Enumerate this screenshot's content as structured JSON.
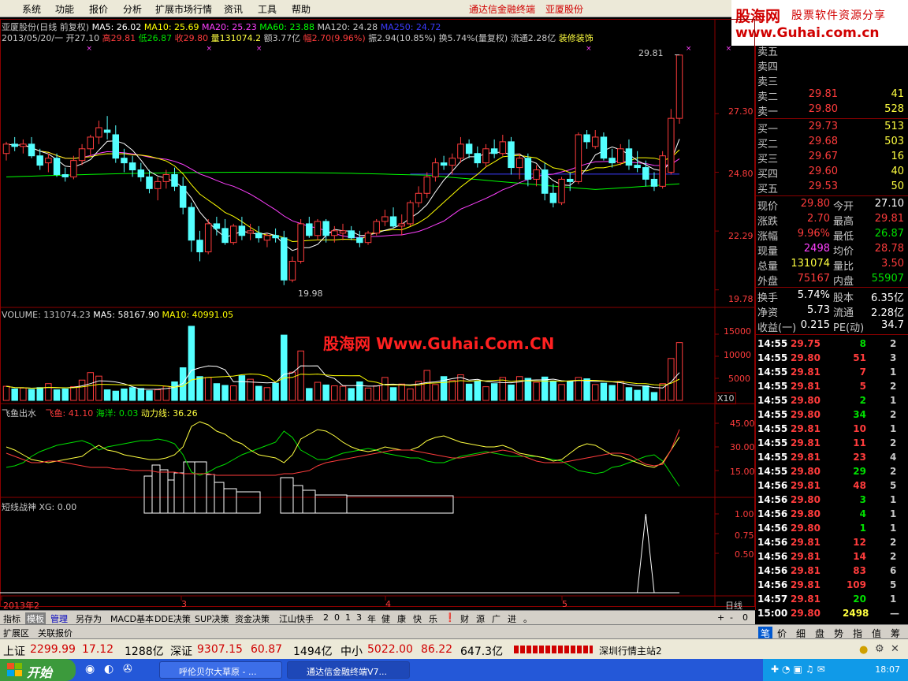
{
  "menu": {
    "items": [
      "系统",
      "功能",
      "报价",
      "分析",
      "扩展市场行情",
      "资讯",
      "工具",
      "帮助"
    ],
    "right_title": "通达信金融终端",
    "right_stock": "亚厦股份"
  },
  "logo": {
    "brand": "股海网",
    "tagline": "股票软件资源分享",
    "url": "www.Guhai.com.cn"
  },
  "chart_header": {
    "stock": "亚厦股份(日线 前复权)",
    "ma5": "MA5: 26.02",
    "ma10": "MA10: 25.69",
    "ma20": "MA20: 25.23",
    "ma60": "MA60: 23.88",
    "ma120": "MA120: 24.28",
    "ma250": "MA250: 24.72"
  },
  "info_line": {
    "date": "2013/05/20/一",
    "open": "开27.10",
    "high": "高29.81",
    "low": "低26.87",
    "close": "收29.80",
    "vol": "量131074.2",
    "amt": "额3.77亿",
    "fu": "幅2.70(9.96%)",
    "zhen": "振2.94(10.85%)",
    "huan": "换5.74%(量复权)",
    "liutong": "流通2.28亿",
    "industry": "装修装饰"
  },
  "price_axis": [
    "27.30",
    "24.80",
    "22.29",
    "19.78"
  ],
  "price_notes": {
    "high": "29.81",
    "low": "19.98"
  },
  "volume_header": {
    "vol": "VOLUME: 131074.23",
    "ma5": "MA5: 58167.90",
    "ma10": "MA10: 40991.05"
  },
  "volume_axis": [
    "15000",
    "10000",
    "5000"
  ],
  "volume_unit": "X10",
  "watermark": "股海网 Www.Guhai.Com.CN",
  "ind1_header": {
    "name": "飞鱼出水",
    "fy": "飞鱼: 41.10",
    "hy": "海洋: 0.03",
    "dl": "动力线: 36.26"
  },
  "ind1_axis": [
    "45.00",
    "30.00",
    "15.00"
  ],
  "ind2_header": {
    "name": "短线战神",
    "xg": "XG: 0.00"
  },
  "ind2_axis": [
    "1.00",
    "0.75",
    "0.50"
  ],
  "date_axis": {
    "year": "2013年2",
    "m3": "3",
    "m4": "4",
    "m5": "5",
    "period": "日线"
  },
  "quote": {
    "sells": [
      {
        "label": "卖五",
        "price": "",
        "vol": ""
      },
      {
        "label": "卖四",
        "price": "",
        "vol": ""
      },
      {
        "label": "卖三",
        "price": "",
        "vol": ""
      },
      {
        "label": "卖二",
        "price": "29.81",
        "vol": "41"
      },
      {
        "label": "卖一",
        "price": "29.80",
        "vol": "528"
      }
    ],
    "buys": [
      {
        "label": "买一",
        "price": "29.73",
        "vol": "513"
      },
      {
        "label": "买二",
        "price": "29.68",
        "vol": "503"
      },
      {
        "label": "买三",
        "price": "29.67",
        "vol": "16"
      },
      {
        "label": "买四",
        "price": "29.60",
        "vol": "40"
      },
      {
        "label": "买五",
        "price": "29.53",
        "vol": "50"
      }
    ],
    "stats": [
      {
        "l1": "现价",
        "v1": "29.80",
        "l2": "今开",
        "v2": "27.10",
        "c1": "#ff3c3c",
        "c2": "#ffffff"
      },
      {
        "l1": "涨跌",
        "v1": "2.70",
        "l2": "最高",
        "v2": "29.81",
        "c1": "#ff3c3c",
        "c2": "#ff3c3c"
      },
      {
        "l1": "涨幅",
        "v1": "9.96%",
        "l2": "最低",
        "v2": "26.87",
        "c1": "#ff3c3c",
        "c2": "#00e000"
      },
      {
        "l1": "现量",
        "v1": "2498",
        "l2": "均价",
        "v2": "28.78",
        "c1": "#ff40ff",
        "c2": "#ff3c3c"
      },
      {
        "l1": "总量",
        "v1": "131074",
        "l2": "量比",
        "v2": "3.50",
        "c1": "#ffff40",
        "c2": "#ff3c3c"
      },
      {
        "l1": "外盘",
        "v1": "75167",
        "l2": "内盘",
        "v2": "55907",
        "c1": "#ff3c3c",
        "c2": "#00e000"
      },
      {
        "l1": "换手",
        "v1": "5.74%",
        "l2": "股本",
        "v2": "6.35亿",
        "c1": "#ffffff",
        "c2": "#ffffff"
      },
      {
        "l1": "净资",
        "v1": "5.73",
        "l2": "流通",
        "v2": "2.28亿",
        "c1": "#ffffff",
        "c2": "#ffffff"
      },
      {
        "l1": "收益(一)",
        "v1": "0.215",
        "l2": "PE(动)",
        "v2": "34.7",
        "c1": "#ffffff",
        "c2": "#ffffff"
      }
    ]
  },
  "ticks": [
    {
      "t": "14:55",
      "p": "29.75",
      "v": "8",
      "n": "2",
      "c": "#00e000"
    },
    {
      "t": "14:55",
      "p": "29.80",
      "v": "51",
      "n": "3",
      "c": "#ff3c3c"
    },
    {
      "t": "14:55",
      "p": "29.81",
      "v": "7",
      "n": "1",
      "c": "#ff3c3c"
    },
    {
      "t": "14:55",
      "p": "29.81",
      "v": "5",
      "n": "2",
      "c": "#ff3c3c"
    },
    {
      "t": "14:55",
      "p": "29.80",
      "v": "2",
      "n": "1",
      "c": "#00e000"
    },
    {
      "t": "14:55",
      "p": "29.80",
      "v": "34",
      "n": "2",
      "c": "#00e000"
    },
    {
      "t": "14:55",
      "p": "29.81",
      "v": "10",
      "n": "1",
      "c": "#ff3c3c"
    },
    {
      "t": "14:55",
      "p": "29.81",
      "v": "11",
      "n": "2",
      "c": "#ff3c3c"
    },
    {
      "t": "14:55",
      "p": "29.81",
      "v": "23",
      "n": "4",
      "c": "#ff3c3c"
    },
    {
      "t": "14:55",
      "p": "29.80",
      "v": "29",
      "n": "2",
      "c": "#00e000"
    },
    {
      "t": "14:56",
      "p": "29.81",
      "v": "48",
      "n": "5",
      "c": "#ff3c3c"
    },
    {
      "t": "14:56",
      "p": "29.80",
      "v": "3",
      "n": "1",
      "c": "#00e000"
    },
    {
      "t": "14:56",
      "p": "29.80",
      "v": "4",
      "n": "1",
      "c": "#00e000"
    },
    {
      "t": "14:56",
      "p": "29.80",
      "v": "1",
      "n": "1",
      "c": "#00e000"
    },
    {
      "t": "14:56",
      "p": "29.81",
      "v": "12",
      "n": "2",
      "c": "#ff3c3c"
    },
    {
      "t": "14:56",
      "p": "29.81",
      "v": "14",
      "n": "2",
      "c": "#ff3c3c"
    },
    {
      "t": "14:56",
      "p": "29.81",
      "v": "83",
      "n": "6",
      "c": "#ff3c3c"
    },
    {
      "t": "14:56",
      "p": "29.81",
      "v": "109",
      "n": "5",
      "c": "#ff3c3c"
    },
    {
      "t": "14:57",
      "p": "29.81",
      "v": "20",
      "n": "1",
      "c": "#00e000"
    },
    {
      "t": "15:00",
      "p": "29.80",
      "v": "2498",
      "n": "—",
      "c": "#ffff40"
    }
  ],
  "bottom_tabs": [
    "指标",
    "模板",
    "管理",
    "另存为",
    "MACD基本",
    "DDE决策",
    "SUP决策",
    "资金决策",
    "江山快手",
    "2",
    "0",
    "1",
    "3",
    "年",
    "健",
    "康",
    "快",
    "乐",
    "❗",
    "财",
    "源",
    "广",
    "进",
    "。"
  ],
  "bottom_right": [
    "+",
    "-",
    "0"
  ],
  "tabs2": [
    "扩展区",
    "关联报价"
  ],
  "right_tabs": [
    "笔",
    "价",
    "细",
    "盘",
    "势",
    "指",
    "值",
    "筹"
  ],
  "index_bar": {
    "sh_label": "上证",
    "sh_val": "2299.99",
    "sh_chg": "17.12",
    "sh_amt": "1288亿",
    "sz_label": "深证",
    "sz_val": "9307.15",
    "sz_chg": "60.87",
    "sz_amt": "1494亿",
    "zx_label": "中小",
    "zx_val": "5022.00",
    "zx_chg": "86.22",
    "zx_amt": "647.3亿",
    "server": "深圳行情主站2"
  },
  "taskbar": {
    "start": "开始",
    "task1": "呼伦贝尔大草原 - ...",
    "task2": "通达信金融终端V7...",
    "clock": "18:07"
  },
  "chart_data": {
    "type": "candlestick",
    "price_range": [
      19.78,
      29.81
    ],
    "candles": [
      [
        25.6,
        26.1,
        25.3,
        26.0
      ],
      [
        26.0,
        26.3,
        25.7,
        25.9
      ],
      [
        25.9,
        26.2,
        25.6,
        26.0
      ],
      [
        26.0,
        26.3,
        25.4,
        25.5
      ],
      [
        25.5,
        25.8,
        24.9,
        25.1
      ],
      [
        25.2,
        25.6,
        24.8,
        25.4
      ],
      [
        25.4,
        25.6,
        24.6,
        24.7
      ],
      [
        24.7,
        25.0,
        24.4,
        24.6
      ],
      [
        24.6,
        25.5,
        24.5,
        25.3
      ],
      [
        25.3,
        26.0,
        25.1,
        25.8
      ],
      [
        25.8,
        26.4,
        25.5,
        26.3
      ],
      [
        26.3,
        27.0,
        26.0,
        26.7
      ],
      [
        26.6,
        27.2,
        26.2,
        26.5
      ],
      [
        26.4,
        26.8,
        25.2,
        25.4
      ],
      [
        25.4,
        25.8,
        24.8,
        25.2
      ],
      [
        25.2,
        25.5,
        24.6,
        24.9
      ],
      [
        24.9,
        25.2,
        24.4,
        24.6
      ],
      [
        24.6,
        24.9,
        23.9,
        24.1
      ],
      [
        24.1,
        24.6,
        23.6,
        24.4
      ],
      [
        24.4,
        24.9,
        24.1,
        24.7
      ],
      [
        24.7,
        25.0,
        24.0,
        24.2
      ],
      [
        24.2,
        24.6,
        23.0,
        23.3
      ],
      [
        23.3,
        23.5,
        21.4,
        21.9
      ],
      [
        21.9,
        22.3,
        21.0,
        21.4
      ],
      [
        21.4,
        22.8,
        21.3,
        22.6
      ],
      [
        22.6,
        22.9,
        22.1,
        22.4
      ],
      [
        22.4,
        22.8,
        21.7,
        21.8
      ],
      [
        21.8,
        22.6,
        21.7,
        22.5
      ],
      [
        22.5,
        22.9,
        21.9,
        22.1
      ],
      [
        22.2,
        22.6,
        21.9,
        22.3
      ],
      [
        22.2,
        22.5,
        21.8,
        22.0
      ],
      [
        21.9,
        22.2,
        21.6,
        22.1
      ],
      [
        22.1,
        22.4,
        21.8,
        22.0
      ],
      [
        22.0,
        22.3,
        19.98,
        20.2
      ],
      [
        20.2,
        21.2,
        20.1,
        21.0
      ],
      [
        21.0,
        22.8,
        20.9,
        22.6
      ],
      [
        22.6,
        22.9,
        22.0,
        22.1
      ],
      [
        22.1,
        22.8,
        21.9,
        22.7
      ],
      [
        22.7,
        22.8,
        21.8,
        22.1
      ],
      [
        22.1,
        22.5,
        21.8,
        22.3
      ],
      [
        22.2,
        22.6,
        21.9,
        22.3
      ],
      [
        22.3,
        22.5,
        21.9,
        22.0
      ],
      [
        22.0,
        22.3,
        21.6,
        21.8
      ],
      [
        21.8,
        22.3,
        21.7,
        22.2
      ],
      [
        22.2,
        22.8,
        22.1,
        22.7
      ],
      [
        22.7,
        23.2,
        22.5,
        22.9
      ],
      [
        22.9,
        23.3,
        22.4,
        22.5
      ],
      [
        22.5,
        23.0,
        22.1,
        22.6
      ],
      [
        22.6,
        23.6,
        22.5,
        23.5
      ],
      [
        23.5,
        24.2,
        23.3,
        23.9
      ],
      [
        23.9,
        24.8,
        23.7,
        24.6
      ],
      [
        24.6,
        25.4,
        24.4,
        25.2
      ],
      [
        25.2,
        25.5,
        24.9,
        25.1
      ],
      [
        25.1,
        25.6,
        24.7,
        25.4
      ],
      [
        25.4,
        26.3,
        25.2,
        26.0
      ],
      [
        26.0,
        26.2,
        25.4,
        25.6
      ],
      [
        25.6,
        25.9,
        25.0,
        25.2
      ],
      [
        25.2,
        26.0,
        25.0,
        25.8
      ],
      [
        25.8,
        26.2,
        25.4,
        25.6
      ],
      [
        25.6,
        26.4,
        25.5,
        26.1
      ],
      [
        26.1,
        26.3,
        24.7,
        25.0
      ],
      [
        25.0,
        25.6,
        24.5,
        25.4
      ],
      [
        25.4,
        25.6,
        24.2,
        24.5
      ],
      [
        24.5,
        25.1,
        24.2,
        24.9
      ],
      [
        24.9,
        25.2,
        23.6,
        23.9
      ],
      [
        23.9,
        24.3,
        23.3,
        23.5
      ],
      [
        23.5,
        24.6,
        23.4,
        24.5
      ],
      [
        24.5,
        24.8,
        24.0,
        24.4
      ],
      [
        24.4,
        26.5,
        24.3,
        26.4
      ],
      [
        26.4,
        26.6,
        25.8,
        26.1
      ],
      [
        25.9,
        26.6,
        25.8,
        26.3
      ],
      [
        26.3,
        26.5,
        25.3,
        25.4
      ],
      [
        25.4,
        25.8,
        25.0,
        25.2
      ],
      [
        25.2,
        26.0,
        25.1,
        25.8
      ],
      [
        25.8,
        26.2,
        24.9,
        25.1
      ],
      [
        25.1,
        25.7,
        24.8,
        25.0
      ],
      [
        25.0,
        25.3,
        24.2,
        24.5
      ],
      [
        24.5,
        24.8,
        24.0,
        24.2
      ],
      [
        24.2,
        25.7,
        24.1,
        25.5
      ],
      [
        24.8,
        27.5,
        24.7,
        27.1
      ],
      [
        27.1,
        29.81,
        26.87,
        29.8
      ]
    ],
    "volume": [
      3200,
      2600,
      2800,
      2500,
      2900,
      3800,
      2400,
      2600,
      3100,
      4600,
      6300,
      5500,
      2400,
      2100,
      2600,
      2900,
      2700,
      2200,
      2400,
      3200,
      4200,
      7400,
      16800,
      5400,
      5200,
      3800,
      3400,
      3300,
      5600,
      4800,
      3200,
      2900,
      3900,
      14800,
      6400,
      11200,
      2700,
      4100,
      3500,
      3300,
      3200,
      2700,
      4200,
      2800,
      3300,
      5200,
      2900,
      3700,
      2600,
      4300,
      6800,
      3600,
      5400,
      4500,
      5800,
      3700,
      4400,
      3100,
      3800,
      5200,
      3500,
      5400,
      5000,
      4100,
      5300,
      4300,
      3600,
      4200,
      5200,
      4900,
      3600,
      3900,
      3400,
      4300,
      2900,
      2300,
      3300,
      1800,
      3800,
      9500,
      13100
    ],
    "ind1_red": [
      26,
      24,
      22,
      20,
      20,
      21,
      21,
      20,
      19,
      18,
      17,
      17,
      17,
      16,
      16,
      15,
      15,
      15,
      14,
      14,
      14,
      13,
      13,
      13,
      13,
      12,
      12,
      12,
      12,
      12,
      12,
      12,
      12,
      13,
      13,
      14,
      15,
      18,
      20,
      21,
      22,
      23,
      24,
      25,
      26,
      27,
      28,
      28,
      28,
      27,
      26,
      25,
      24,
      23,
      23,
      24,
      25,
      26,
      27,
      28,
      27,
      25,
      23,
      21,
      20,
      20,
      20,
      21,
      22,
      23,
      24,
      25,
      26,
      26,
      25,
      22,
      19,
      18,
      19,
      28,
      41.1
    ],
    "ind1_yellow": [
      30,
      28,
      25,
      22,
      21,
      20,
      21,
      22,
      23,
      24,
      28,
      31,
      28,
      27,
      25,
      24,
      23,
      22,
      22,
      23,
      25,
      30,
      43,
      46,
      44,
      40,
      38,
      34,
      32,
      28,
      25,
      24,
      23,
      20,
      25,
      35,
      38,
      41,
      40,
      37,
      33,
      30,
      28,
      27,
      28,
      30,
      29,
      28,
      28,
      30,
      34,
      36,
      37,
      35,
      33,
      32,
      31,
      30,
      30,
      31,
      29,
      26,
      25,
      24,
      23,
      21,
      22,
      26,
      30,
      32,
      31,
      28,
      25,
      24,
      22,
      20,
      18,
      17,
      20,
      28,
      36.26
    ],
    "ind1_green": [
      17,
      18,
      20,
      24,
      27,
      29,
      31,
      32,
      33,
      34,
      32,
      28,
      30,
      31,
      32,
      33,
      34,
      34,
      35,
      34,
      32,
      25,
      14,
      12,
      14,
      17,
      19,
      22,
      25,
      27,
      29,
      31,
      33,
      40,
      36,
      28,
      25,
      22,
      22,
      24,
      26,
      27,
      28,
      29,
      28,
      26,
      25,
      24,
      23,
      23,
      21,
      20,
      20,
      22,
      24,
      25,
      26,
      27,
      26,
      25,
      24,
      24,
      24,
      24,
      23,
      22,
      21,
      18,
      15,
      14,
      13,
      14,
      17,
      18,
      20,
      22,
      24,
      25,
      21,
      13,
      5
    ],
    "ind2_xg": [
      0,
      0,
      0,
      0,
      0,
      0,
      0,
      0,
      0,
      0,
      0,
      0,
      0,
      0,
      0,
      0,
      0,
      0,
      0,
      0,
      0,
      0,
      0,
      0,
      0,
      0,
      0,
      0,
      0,
      0,
      0,
      0,
      0,
      0,
      0,
      0,
      0,
      0,
      0,
      0,
      0,
      0,
      0,
      0,
      0,
      0,
      0,
      0,
      0,
      0,
      0,
      0,
      0,
      0,
      0,
      0,
      0,
      0,
      0,
      0,
      0,
      0,
      0,
      0,
      0,
      0,
      0,
      0,
      0,
      0,
      0,
      0,
      0,
      0,
      0,
      0,
      1,
      0,
      0,
      0,
      0
    ]
  },
  "colors": {
    "up": "#ff3c3c",
    "down": "#54ffff",
    "axis": "#8b0000",
    "ma5": "#ffffff",
    "ma10": "#ffff00",
    "ma20": "#ff40ff",
    "ma60": "#00ff00",
    "ma250": "#3c3cff"
  }
}
